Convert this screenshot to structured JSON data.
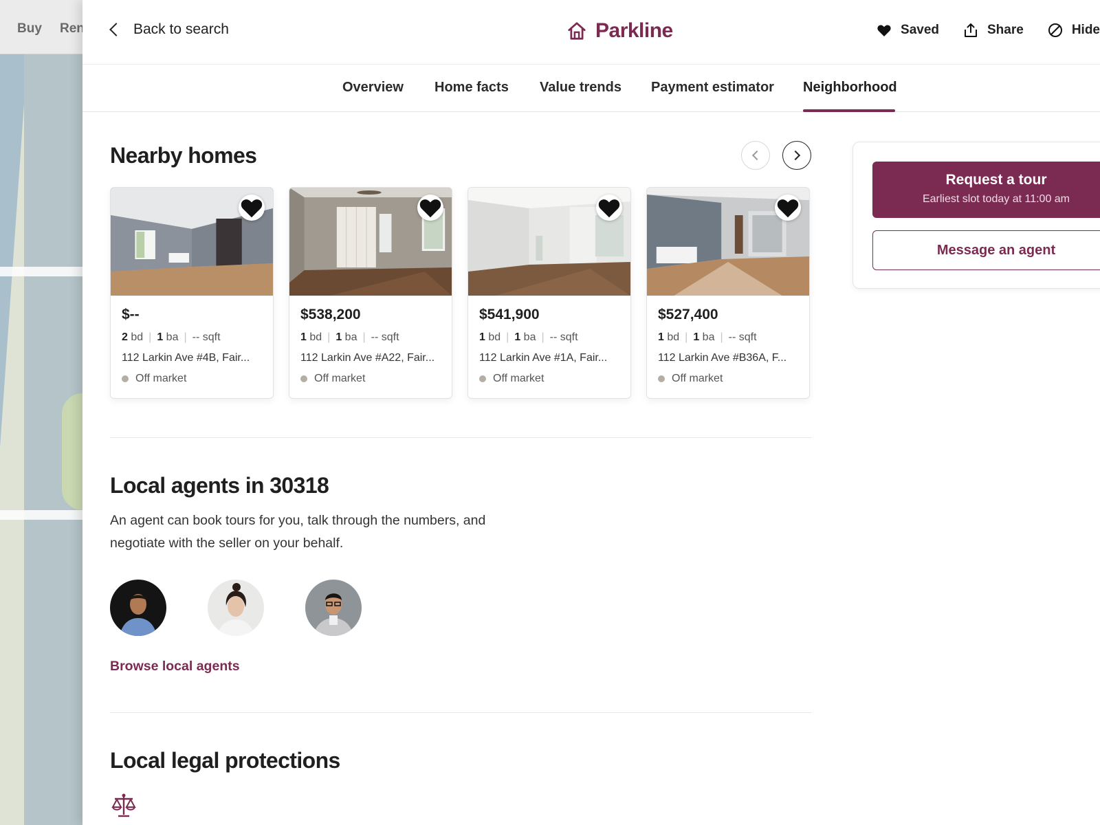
{
  "background_nav": {
    "buy": "Buy",
    "rent": "Ren"
  },
  "header": {
    "back_label": "Back to search",
    "brand": "Parkline",
    "brand_color": "#7b2a52",
    "actions": {
      "saved": "Saved",
      "share": "Share",
      "hide": "Hide"
    }
  },
  "tabs": {
    "overview": "Overview",
    "home_facts": "Home facts",
    "value_trends": "Value trends",
    "payment_estimator": "Payment estimator",
    "neighborhood": "Neighborhood",
    "active": "Neighborhood"
  },
  "nearby": {
    "title": "Nearby homes",
    "homes": [
      {
        "price": "$--",
        "beds": "2",
        "bd_unit": "bd",
        "baths": "1",
        "ba_unit": "ba",
        "sqft": "-- sqft",
        "address": "112 Larkin Ave #4B, Fair...",
        "status": "Off market"
      },
      {
        "price": "$538,200",
        "beds": "1",
        "bd_unit": "bd",
        "baths": "1",
        "ba_unit": "ba",
        "sqft": "-- sqft",
        "address": "112 Larkin Ave #A22, Fair...",
        "status": "Off market"
      },
      {
        "price": "$541,900",
        "beds": "1",
        "bd_unit": "bd",
        "baths": "1",
        "ba_unit": "ba",
        "sqft": "-- sqft",
        "address": "112 Larkin Ave #1A, Fair...",
        "status": "Off market"
      },
      {
        "price": "$527,400",
        "beds": "1",
        "bd_unit": "bd",
        "baths": "1",
        "ba_unit": "ba",
        "sqft": "-- sqft",
        "address": "112 Larkin Ave #B36A, F...",
        "status": "Off market"
      }
    ]
  },
  "agents": {
    "title": "Local agents in 30318",
    "description": "An agent can book tours for you, talk through the numbers, and negotiate with the seller on your behalf.",
    "link": "Browse local agents"
  },
  "legal": {
    "title": "Local legal protections",
    "icon": "scales-icon"
  },
  "cta": {
    "tour_label": "Request a tour",
    "tour_sub": "Earliest slot today at 11:00 am",
    "message_label": "Message an agent"
  }
}
